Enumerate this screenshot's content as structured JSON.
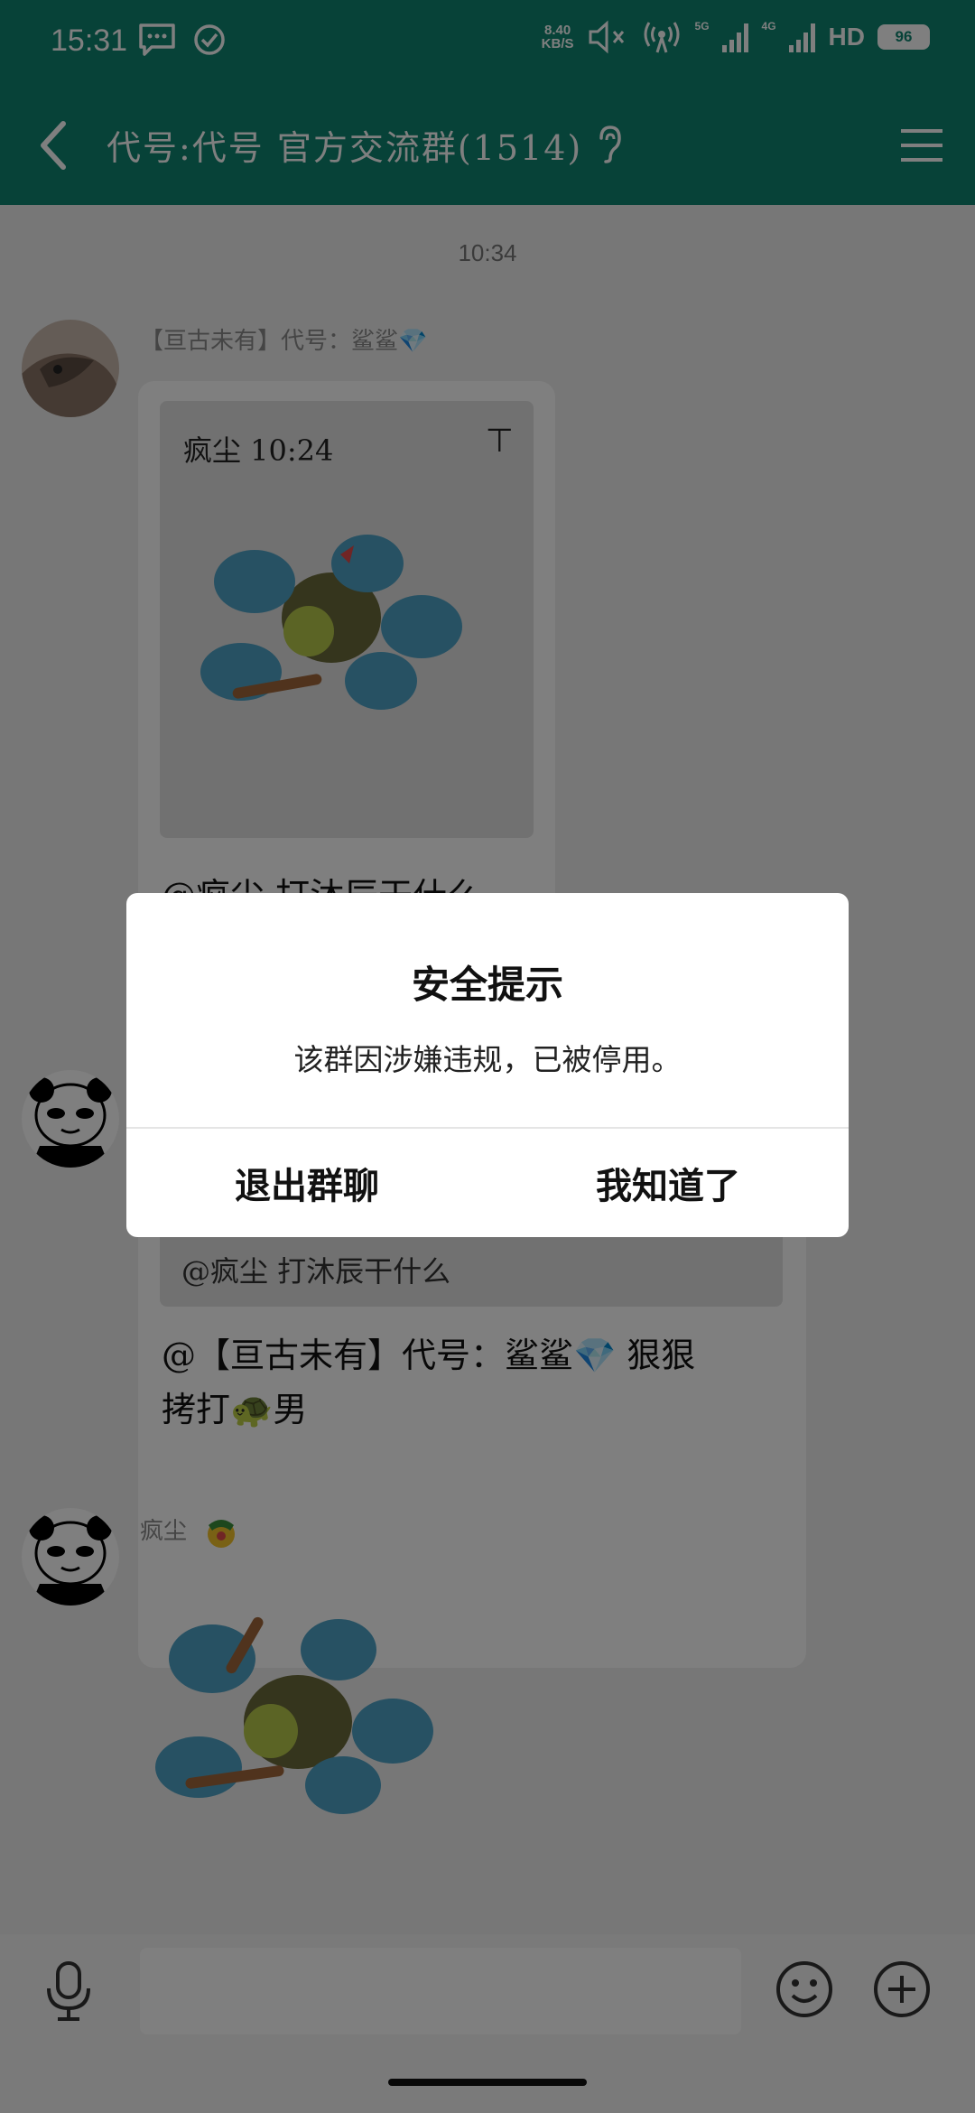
{
  "status_bar": {
    "time": "15:31",
    "net_speed_value": "8.40",
    "net_speed_unit": "KB/S",
    "sig1_label": "5G",
    "sig2_label": "4G",
    "hd_label": "HD",
    "battery": "96"
  },
  "header": {
    "title": "代号:代号  官方交流群(1514)"
  },
  "chat": {
    "time_separator": "10:34",
    "message1": {
      "sender": "【亘古未有】代号：鲨鲨💎",
      "quote_header": "疯尘 10:24",
      "text_partial": "@疯尘 打沐辰干什么"
    },
    "message2": {
      "quote_text": "@疯尘 打沐辰干什么",
      "text_line1": "@【亘古未有】代号：鲨鲨💎 狠狠",
      "text_line2": "拷打🐢男"
    },
    "message3": {
      "sender": "疯尘"
    }
  },
  "dialog": {
    "title": "安全提示",
    "message": "该群因涉嫌违规，已被停用。",
    "exit_label": "退出群聊",
    "ok_label": "我知道了"
  },
  "colors": {
    "header_bg": "#0e8470",
    "overlay": "rgba(0,0,0,0.5)"
  }
}
